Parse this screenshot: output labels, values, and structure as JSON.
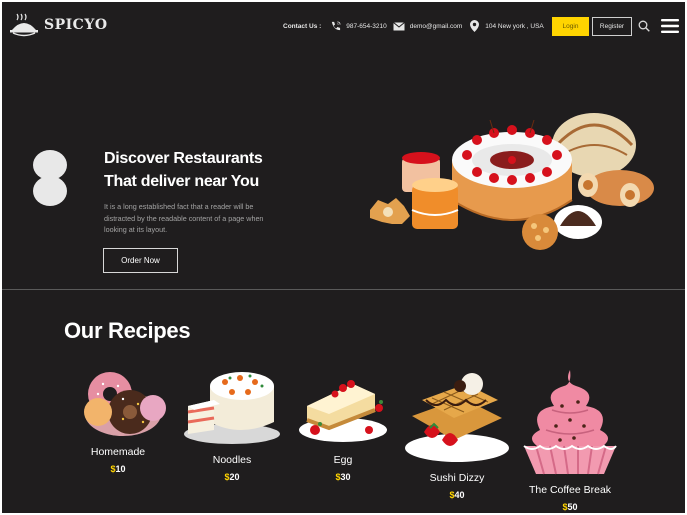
{
  "brand": {
    "name": "SPICYO"
  },
  "header": {
    "contact_label": "Contact Us :",
    "phone": "987-654-3210",
    "email": "demo@gmail.com",
    "address": "104 New york , USA",
    "login_label": "Login",
    "register_label": "Register"
  },
  "hero": {
    "title_line1": "Discover Restaurants",
    "title_line2": "That deliver near You",
    "description": "It is a long established fact that a reader will be distracted by the readable content of a page when looking at its layout.",
    "cta_label": "Order Now"
  },
  "recipes": {
    "title": "Our Recipes",
    "currency": "$",
    "items": [
      {
        "name": "Homemade",
        "price": "10"
      },
      {
        "name": "Noodles",
        "price": "20"
      },
      {
        "name": "Egg",
        "price": "30"
      },
      {
        "name": "Sushi Dizzy",
        "price": "40"
      },
      {
        "name": "The Coffee Break",
        "price": "50"
      }
    ]
  },
  "colors": {
    "background": "#1f1d1e",
    "accent": "#ffd400",
    "text": "#ffffff"
  }
}
